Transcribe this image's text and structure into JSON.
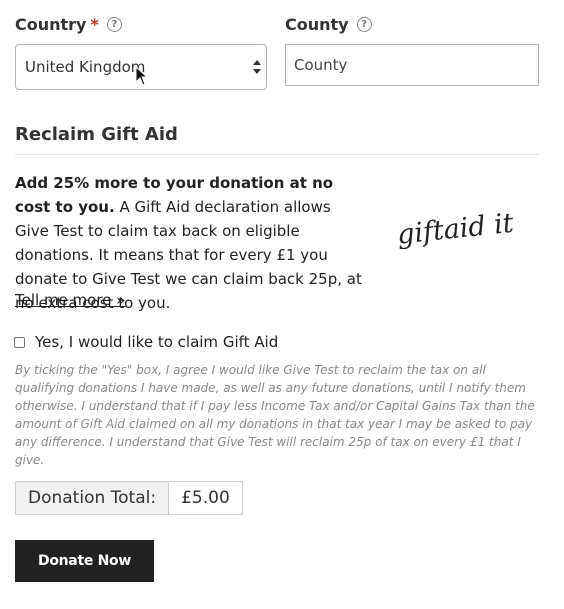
{
  "country": {
    "label": "Country",
    "required_mark": "*",
    "help_icon": "question-circle-icon",
    "selected": "United Kingdom"
  },
  "county": {
    "label": "County",
    "help_icon": "question-circle-icon",
    "placeholder": "County"
  },
  "gift_aid": {
    "title": "Reclaim Gift Aid",
    "intro_bold": "Add 25% more to your donation at no cost to you.",
    "intro_text": " A Gift Aid declaration allows Give Test to claim tax back on eligible donations. It means that for every £1 you donate to Give Test we can claim back 25p, at no extra cost to you.",
    "tell_more": "Tell me more »",
    "logo_text": "giftaid it",
    "checkbox_label": "Yes, I would like to claim Gift Aid",
    "disclaimer": "By ticking the \"Yes\" box, I agree I would like Give Test to reclaim the tax on all qualifying donations I have made, as well as any future donations, until I notify them otherwise. I understand that if I pay less Income Tax and/or Capital Gains Tax than the amount of Gift Aid claimed on all my donations in that tax year I may be asked to pay any difference. I understand that Give Test will reclaim 25p of tax on every £1 that I give."
  },
  "donation_total": {
    "label": "Donation Total:",
    "value": "£5.00"
  },
  "donate_button": "Donate Now",
  "colors": {
    "button_bg": "#222222",
    "required": "#c0392b",
    "muted_text": "#888888"
  }
}
